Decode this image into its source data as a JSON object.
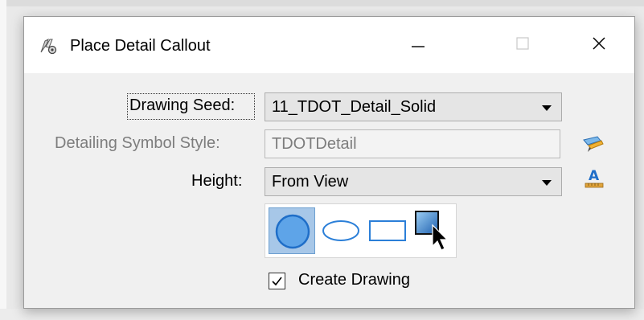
{
  "window": {
    "title": "Place Detail Callout",
    "minimize_icon": "minimize-icon",
    "maximize_icon": "maximize-icon",
    "close_icon": "close-icon"
  },
  "form": {
    "drawing_seed": {
      "label": "Drawing Seed:",
      "value": "11_TDOT_Detail_Solid"
    },
    "detailing_symbol_style": {
      "label": "Detailing Symbol Style:",
      "value": "TDOTDetail",
      "icon": "edit-style-icon"
    },
    "height": {
      "label": "Height:",
      "value": "From View",
      "icon": "text-height-icon"
    },
    "shapes": [
      {
        "name": "circle",
        "icon": "circle-shape-icon",
        "selected": true
      },
      {
        "name": "ellipse",
        "icon": "ellipse-shape-icon",
        "selected": false
      },
      {
        "name": "rectangle",
        "icon": "rectangle-shape-icon",
        "selected": false
      },
      {
        "name": "square",
        "icon": "square-shape-icon",
        "selected": false
      }
    ],
    "create_drawing": {
      "label": "Create Drawing",
      "checked": true
    }
  },
  "colors": {
    "accent_blue": "#2b7fd8",
    "selected_fill": "#a7c7e8",
    "disabled_text": "#7d7d7d"
  }
}
